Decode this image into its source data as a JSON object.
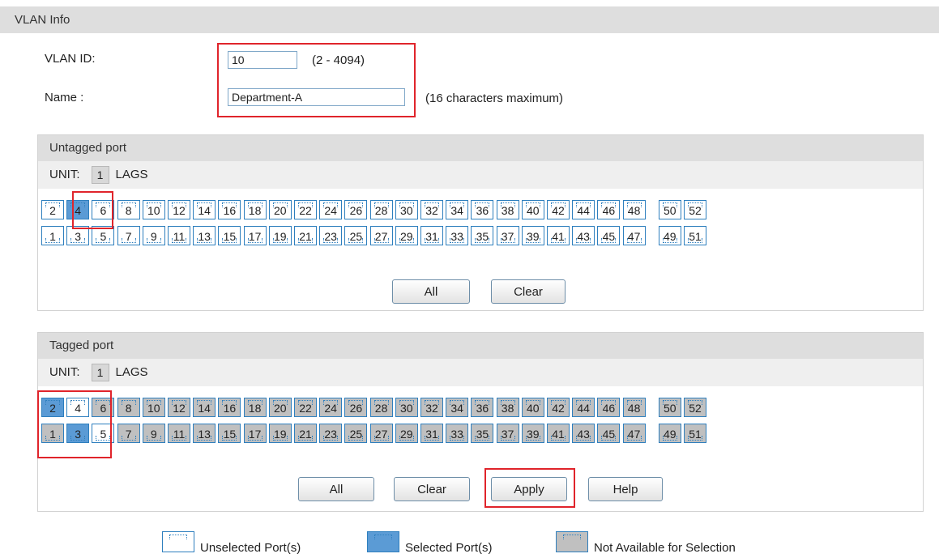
{
  "vlan_info": {
    "title": "VLAN Info",
    "vlan_id_label": "VLAN ID:",
    "vlan_id_value": "10",
    "vlan_id_range": "(2 - 4094)",
    "name_label": "Name :",
    "name_value": "Department-A",
    "name_hint": "(16 characters maximum)"
  },
  "untagged": {
    "title": "Untagged port",
    "unit_label": "UNIT:",
    "unit_value": "1",
    "lags_label": "LAGS",
    "top_ports": [
      "2",
      "4",
      "6",
      "8",
      "10",
      "12",
      "14",
      "16",
      "18",
      "20",
      "22",
      "24",
      "26",
      "28",
      "30",
      "32",
      "34",
      "36",
      "38",
      "40",
      "42",
      "44",
      "46",
      "48",
      "50",
      "52"
    ],
    "bottom_ports": [
      "1",
      "3",
      "5",
      "7",
      "9",
      "11",
      "13",
      "15",
      "17",
      "19",
      "21",
      "23",
      "25",
      "27",
      "29",
      "31",
      "33",
      "35",
      "37",
      "39",
      "41",
      "43",
      "45",
      "47",
      "49",
      "51"
    ],
    "selected": [
      "4"
    ],
    "not_available": [],
    "all_label": "All",
    "clear_label": "Clear"
  },
  "tagged": {
    "title": "Tagged port",
    "unit_label": "UNIT:",
    "unit_value": "1",
    "lags_label": "LAGS",
    "top_ports": [
      "2",
      "4",
      "6",
      "8",
      "10",
      "12",
      "14",
      "16",
      "18",
      "20",
      "22",
      "24",
      "26",
      "28",
      "30",
      "32",
      "34",
      "36",
      "38",
      "40",
      "42",
      "44",
      "46",
      "48",
      "50",
      "52"
    ],
    "bottom_ports": [
      "1",
      "3",
      "5",
      "7",
      "9",
      "11",
      "13",
      "15",
      "17",
      "19",
      "21",
      "23",
      "25",
      "27",
      "29",
      "31",
      "33",
      "35",
      "37",
      "39",
      "41",
      "43",
      "45",
      "47",
      "49",
      "51"
    ],
    "selected": [
      "2",
      "3"
    ],
    "unselected": [
      "4",
      "5"
    ],
    "all_label": "All",
    "clear_label": "Clear",
    "apply_label": "Apply",
    "help_label": "Help"
  },
  "legend": {
    "unselected": "Unselected Port(s)",
    "selected": "Selected Port(s)",
    "not_available": "Not Available for Selection"
  },
  "colors": {
    "selected": "#5b9bd5",
    "not_available": "#c0c0c0",
    "unselected": "#ffffff",
    "highlight": "#e0242b"
  }
}
